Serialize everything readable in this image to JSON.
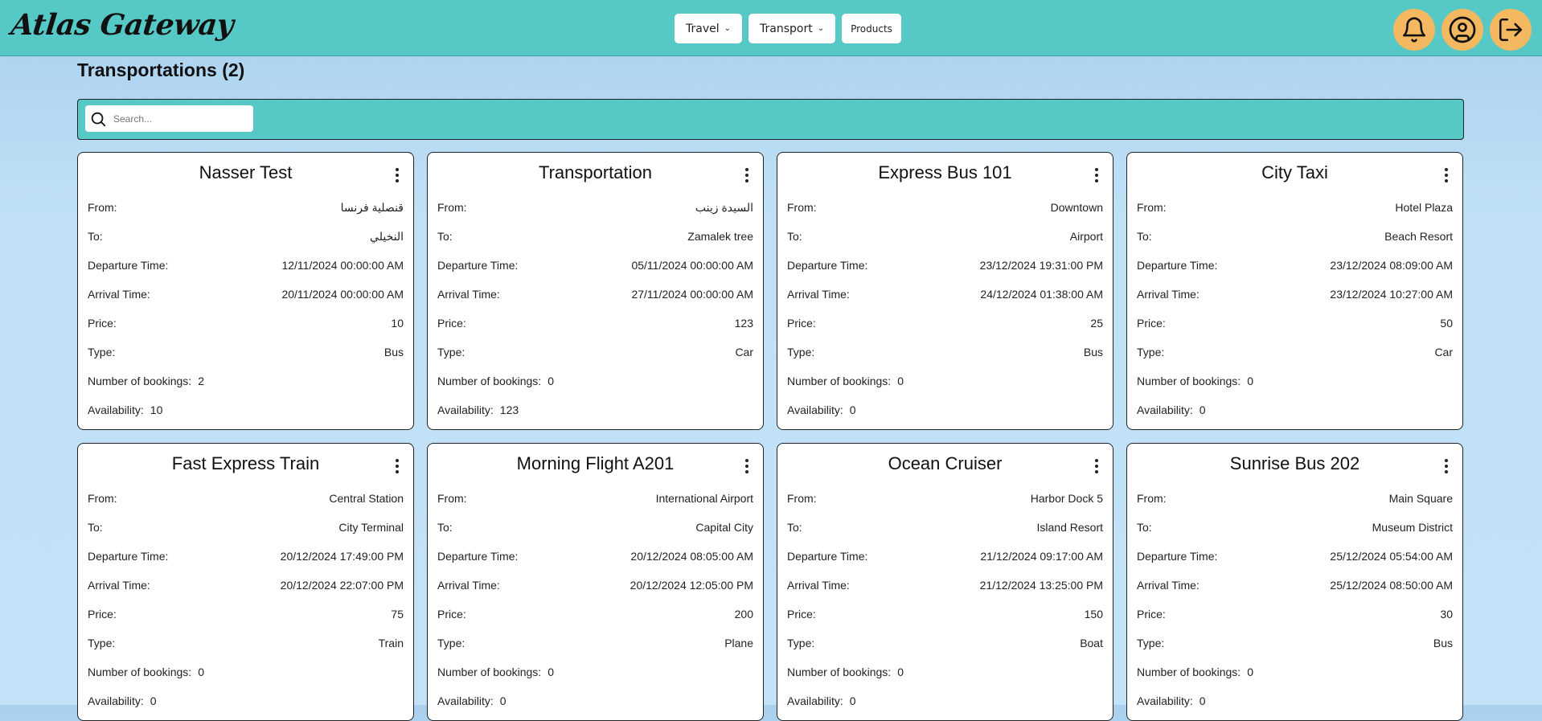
{
  "app": {
    "logo_text": "Atlas Gateway"
  },
  "nav": {
    "travel": "Travel",
    "transport": "Transport",
    "products": "Products"
  },
  "icons": {
    "notifications": "bell-icon",
    "profile": "user-circle-icon",
    "logout": "logout-icon"
  },
  "colors": {
    "topbar": "#56c8c6",
    "icon_button": "#f4b860",
    "background": "#bfe0f7"
  },
  "page": {
    "title": "Transportations (2)"
  },
  "search": {
    "placeholder": "Search..."
  },
  "labels": {
    "from": "From:",
    "to": "To:",
    "departure": "Departure Time:",
    "arrival": "Arrival Time:",
    "price": "Price:",
    "type": "Type:",
    "bookings": "Number of bookings:",
    "availability": "Availability:"
  },
  "cards": [
    {
      "title": "Nasser Test",
      "from": "قنصلية فرنسا",
      "to": "النخيلي",
      "departure": "12/11/2024 00:00:00 AM",
      "arrival": "20/11/2024 00:00:00 AM",
      "price": "10",
      "type": "Bus",
      "bookings": "2",
      "availability": "10"
    },
    {
      "title": "Transportation",
      "from": "السيدة زينب",
      "to": "Zamalek tree",
      "departure": "05/11/2024 00:00:00 AM",
      "arrival": "27/11/2024 00:00:00 AM",
      "price": "123",
      "type": "Car",
      "bookings": "0",
      "availability": "123"
    },
    {
      "title": "Express Bus 101",
      "from": "Downtown",
      "to": "Airport",
      "departure": "23/12/2024 19:31:00 PM",
      "arrival": "24/12/2024 01:38:00 AM",
      "price": "25",
      "type": "Bus",
      "bookings": "0",
      "availability": "0"
    },
    {
      "title": "City Taxi",
      "from": "Hotel Plaza",
      "to": "Beach Resort",
      "departure": "23/12/2024 08:09:00 AM",
      "arrival": "23/12/2024 10:27:00 AM",
      "price": "50",
      "type": "Car",
      "bookings": "0",
      "availability": "0"
    },
    {
      "title": "Fast Express Train",
      "from": "Central Station",
      "to": "City Terminal",
      "departure": "20/12/2024 17:49:00 PM",
      "arrival": "20/12/2024 22:07:00 PM",
      "price": "75",
      "type": "Train",
      "bookings": "0",
      "availability": "0"
    },
    {
      "title": "Morning Flight A201",
      "from": "International Airport",
      "to": "Capital City",
      "departure": "20/12/2024 08:05:00 AM",
      "arrival": "20/12/2024 12:05:00 PM",
      "price": "200",
      "type": "Plane",
      "bookings": "0",
      "availability": "0"
    },
    {
      "title": "Ocean Cruiser",
      "from": "Harbor Dock 5",
      "to": "Island Resort",
      "departure": "21/12/2024 09:17:00 AM",
      "arrival": "21/12/2024 13:25:00 PM",
      "price": "150",
      "type": "Boat",
      "bookings": "0",
      "availability": "0"
    },
    {
      "title": "Sunrise Bus 202",
      "from": "Main Square",
      "to": "Museum District",
      "departure": "25/12/2024 05:54:00 AM",
      "arrival": "25/12/2024 08:50:00 AM",
      "price": "30",
      "type": "Bus",
      "bookings": "0",
      "availability": "0"
    }
  ]
}
